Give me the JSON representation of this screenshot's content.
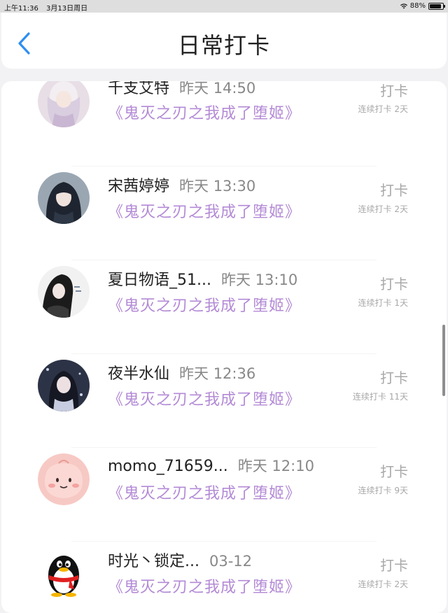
{
  "status_bar": {
    "time": "上午11:36",
    "date": "3月13日周日",
    "battery": "88%",
    "battery_level": 0.88
  },
  "header": {
    "title": "日常打卡",
    "back_icon": "chevron-left-icon",
    "accent_color": "#2f8ef2"
  },
  "list": {
    "title_color": "#b38ad6",
    "items": [
      {
        "name": "千支艾特",
        "time": "昨天 14:50",
        "book": "《鬼灭之刃之我成了堕姬》",
        "action": "打卡",
        "streak": "连续打卡 2天",
        "avatar": "anime-girl-white-hair"
      },
      {
        "name": "宋茜婷婷",
        "time": "昨天 13:30",
        "book": "《鬼灭之刃之我成了堕姬》",
        "action": "打卡",
        "streak": "连续打卡 2天",
        "avatar": "anime-girl-dark-hair"
      },
      {
        "name": "夏日物语_51...",
        "time": "昨天 13:10",
        "book": "《鬼灭之刃之我成了堕姬》",
        "action": "打卡",
        "streak": "连续打卡 1天",
        "avatar": "anime-girl-black-white"
      },
      {
        "name": "夜半水仙",
        "time": "昨天 12:36",
        "book": "《鬼灭之刃之我成了堕姬》",
        "action": "打卡",
        "streak": "连续打卡 11天",
        "avatar": "anime-girl-night"
      },
      {
        "name": "momo_71659...",
        "time": "昨天 12:10",
        "book": "《鬼灭之刃之我成了堕姬》",
        "action": "打卡",
        "streak": "连续打卡 9天",
        "avatar": "pink-blob"
      },
      {
        "name": "时光丶锁定...",
        "time": "03-12",
        "book": "《鬼灭之刃之我成了堕姬》",
        "action": "打卡",
        "streak": "连续打卡 2天",
        "avatar": "qq-penguin"
      }
    ]
  }
}
